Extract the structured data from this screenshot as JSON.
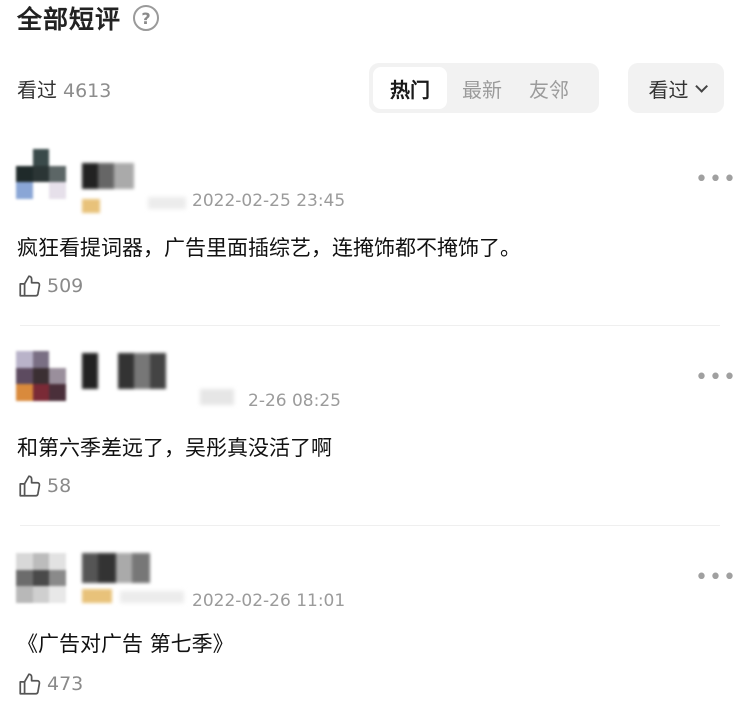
{
  "header": {
    "title": "全部短评",
    "help_icon": "question-circle-icon"
  },
  "summary": {
    "watched_label": "看过",
    "watched_count": "4613"
  },
  "tabs": [
    {
      "label": "热门",
      "active": true
    },
    {
      "label": "最新",
      "active": false
    },
    {
      "label": "友邻",
      "active": false
    }
  ],
  "filter": {
    "label": "看过",
    "icon": "chevron-down-icon"
  },
  "comments": [
    {
      "datetime": "2022-02-25 23:45",
      "text": "疯狂看提词器，广告里面插综艺，连掩饰都不掩饰了。",
      "likes": "509"
    },
    {
      "datetime": "2-26 08:25",
      "text": "和第六季差远了，吴彤真没活了啊",
      "likes": "58"
    },
    {
      "datetime": "2022-02-26 11:01",
      "text": "《广告对广告 第七季》",
      "likes": "473"
    }
  ],
  "more_glyph": "•••"
}
